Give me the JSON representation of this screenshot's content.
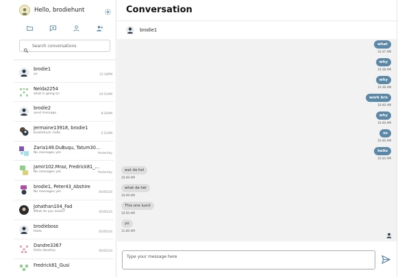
{
  "header": {
    "greeting": "Hello, brodiehunt"
  },
  "search": {
    "placeholder": "Search conversations"
  },
  "conversations": [
    {
      "name": "brodie1",
      "preview": "yo",
      "time": "12:34PM"
    },
    {
      "name": "Nelda2254",
      "preview": "what is going on",
      "time": "10:53AM"
    },
    {
      "name": "brodie2",
      "preview": "send message",
      "time": "8:26AM"
    },
    {
      "name": "Jermaine13918, brodie1",
      "preview": "brodiehunt: hello",
      "time": "5:53AM"
    },
    {
      "name": "Zaria149.DuBuqu, Tatum30...",
      "preview": "No messages yet.",
      "time": "Yesterday"
    },
    {
      "name": "Jamir102.Mraz, Fredrick81_...",
      "preview": "No messages yet.",
      "time": "Yesterday"
    },
    {
      "name": "brodie1, Peter43_Abshire",
      "preview": "No messages yet.",
      "time": "05/05/24"
    },
    {
      "name": "Johathan104_Fad",
      "preview": "What do you mean?",
      "time": "05/05/24"
    },
    {
      "name": "brodieboss",
      "preview": "Hello",
      "time": "05/05/24"
    },
    {
      "name": "Dandre3367",
      "preview": "Hello dandrey",
      "time": "05/05/24"
    },
    {
      "name": "Fredrick81_Gusi",
      "preview": "",
      "time": ""
    }
  ],
  "main": {
    "title": "Conversation",
    "contact_name": "brodie1"
  },
  "messages": [
    {
      "dir": "out",
      "text": "what",
      "time": "10:37 AM"
    },
    {
      "dir": "out",
      "text": "why",
      "time": "10:38 AM"
    },
    {
      "dir": "out",
      "text": "why",
      "time": "10:39 AM"
    },
    {
      "dir": "out",
      "text": "work bro",
      "time": "10:40 AM"
    },
    {
      "dir": "out",
      "text": "why",
      "time": "10:40 AM"
    },
    {
      "dir": "out",
      "text": "so",
      "time": "10:40 AM"
    },
    {
      "dir": "out",
      "text": "hello",
      "time": "10:44 AM"
    },
    {
      "dir": "in",
      "text": "wat da hel",
      "time": "10:49 AM"
    },
    {
      "dir": "in",
      "text": "what da hel",
      "time": "10:49 AM"
    },
    {
      "dir": "in",
      "text": "This one iusnt",
      "time": "10:50 AM"
    },
    {
      "dir": "in",
      "text": "yo",
      "time": "11:00 AM"
    }
  ],
  "composer": {
    "placeholder": "Type your message here"
  },
  "colors": {
    "accent": "#5c88a8",
    "incoming_bubble": "#dedede",
    "thread_bg": "#f2f2f2"
  }
}
